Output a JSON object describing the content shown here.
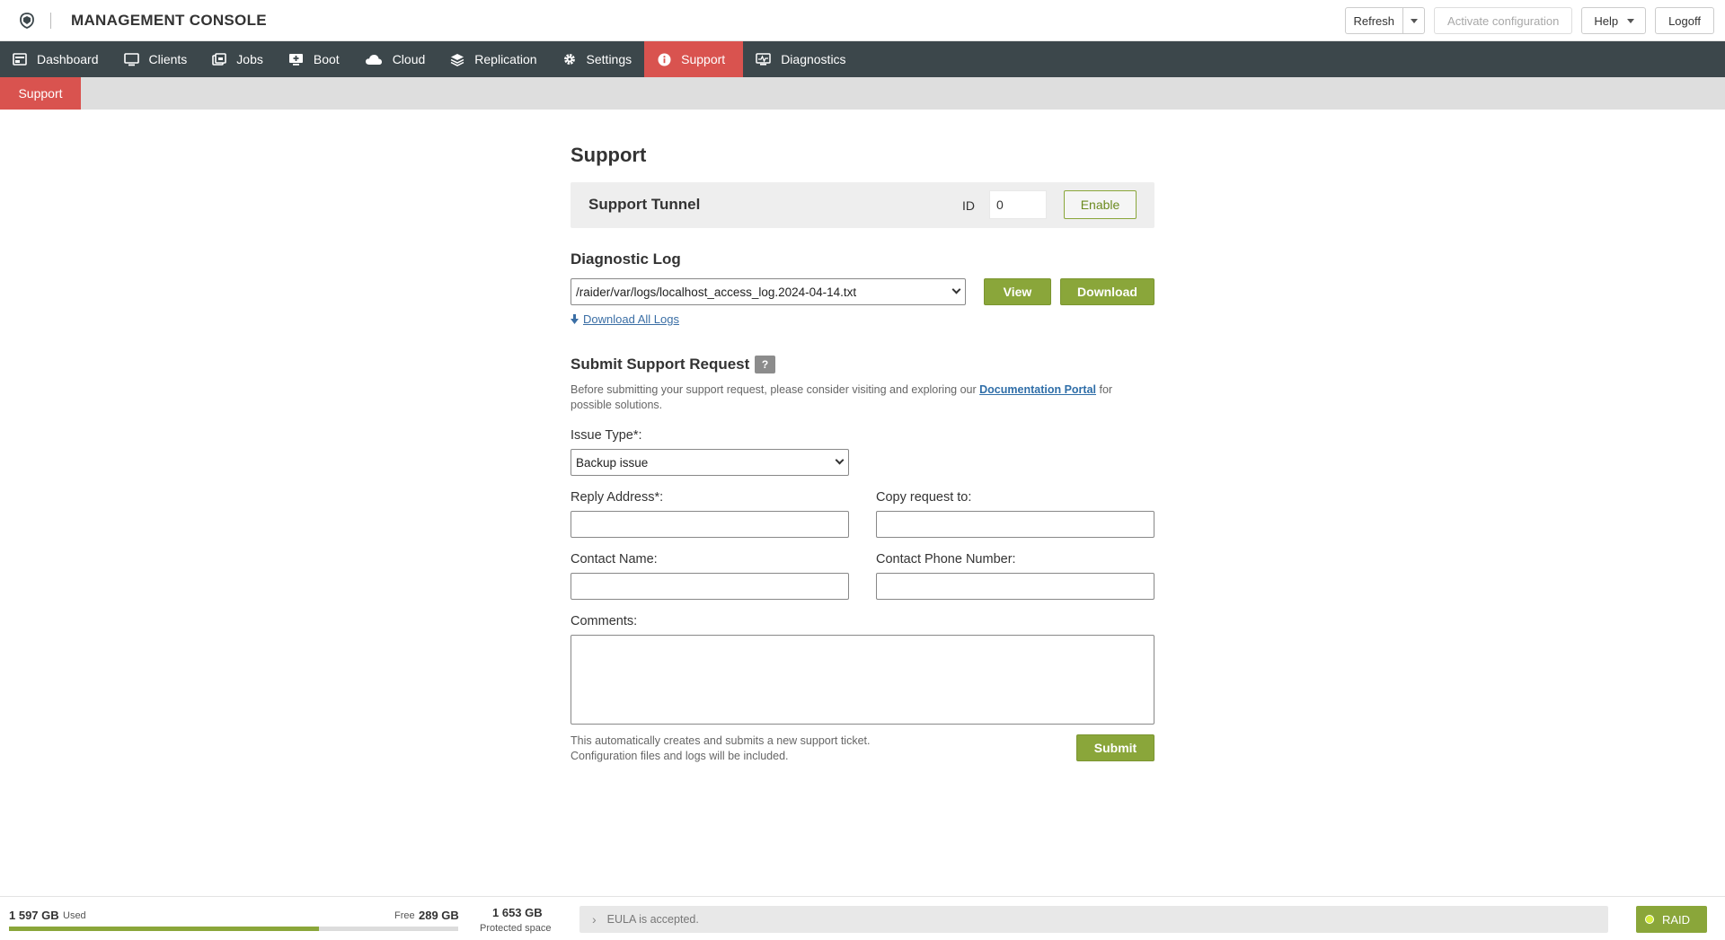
{
  "header": {
    "title": "MANAGEMENT CONSOLE",
    "refresh_label": "Refresh",
    "activate_label": "Activate configuration",
    "help_label": "Help",
    "logoff_label": "Logoff"
  },
  "nav": {
    "items": [
      {
        "label": "Dashboard",
        "icon": "dashboard-icon"
      },
      {
        "label": "Clients",
        "icon": "monitor-icon"
      },
      {
        "label": "Jobs",
        "icon": "jobs-icon"
      },
      {
        "label": "Boot",
        "icon": "boot-icon"
      },
      {
        "label": "Cloud",
        "icon": "cloud-icon"
      },
      {
        "label": "Replication",
        "icon": "replication-icon"
      },
      {
        "label": "Settings",
        "icon": "gear-icon"
      },
      {
        "label": "Support",
        "icon": "info-icon",
        "active": true
      },
      {
        "label": "Diagnostics",
        "icon": "diagnostics-icon"
      }
    ]
  },
  "subnav": {
    "active_tab": "Support"
  },
  "page": {
    "title": "Support"
  },
  "tunnel": {
    "title": "Support Tunnel",
    "id_label": "ID",
    "id_value": "0",
    "enable_label": "Enable"
  },
  "diagnostic": {
    "title": "Diagnostic Log",
    "selected_log": "/raider/var/logs/localhost_access_log.2024-04-14.txt",
    "view_label": "View",
    "download_label": "Download",
    "download_all_label": "Download All Logs"
  },
  "request": {
    "title": "Submit Support Request",
    "help_badge": "?",
    "intro_before": "Before submitting your support request, please consider visiting and exploring our ",
    "intro_link": "Documentation Portal",
    "intro_after": " for possible solutions.",
    "issue_type_label": "Issue Type*:",
    "issue_type_value": "Backup issue",
    "reply_label": "Reply Address*:",
    "reply_value": "",
    "copy_label": "Copy request to:",
    "copy_value": "",
    "contact_name_label": "Contact Name:",
    "contact_name_value": "",
    "contact_phone_label": "Contact Phone Number:",
    "contact_phone_value": "",
    "comments_label": "Comments:",
    "comments_value": "",
    "note_line1": "This automatically creates and submits a new support ticket.",
    "note_line2": "Configuration files and logs will be included.",
    "submit_label": "Submit"
  },
  "footer": {
    "used_value": "1 597 GB",
    "used_label": "Used",
    "free_label": "Free",
    "free_value": "289 GB",
    "usage_fraction": 0.69,
    "protected_value": "1 653 GB",
    "protected_label": "Protected space",
    "eula_text": "EULA is accepted.",
    "raid_label": "RAID"
  },
  "colors": {
    "nav_bg": "#3c474b",
    "active_red": "#d9534f",
    "accent_green": "#8aa63a",
    "link_blue": "#2f6ea8"
  }
}
